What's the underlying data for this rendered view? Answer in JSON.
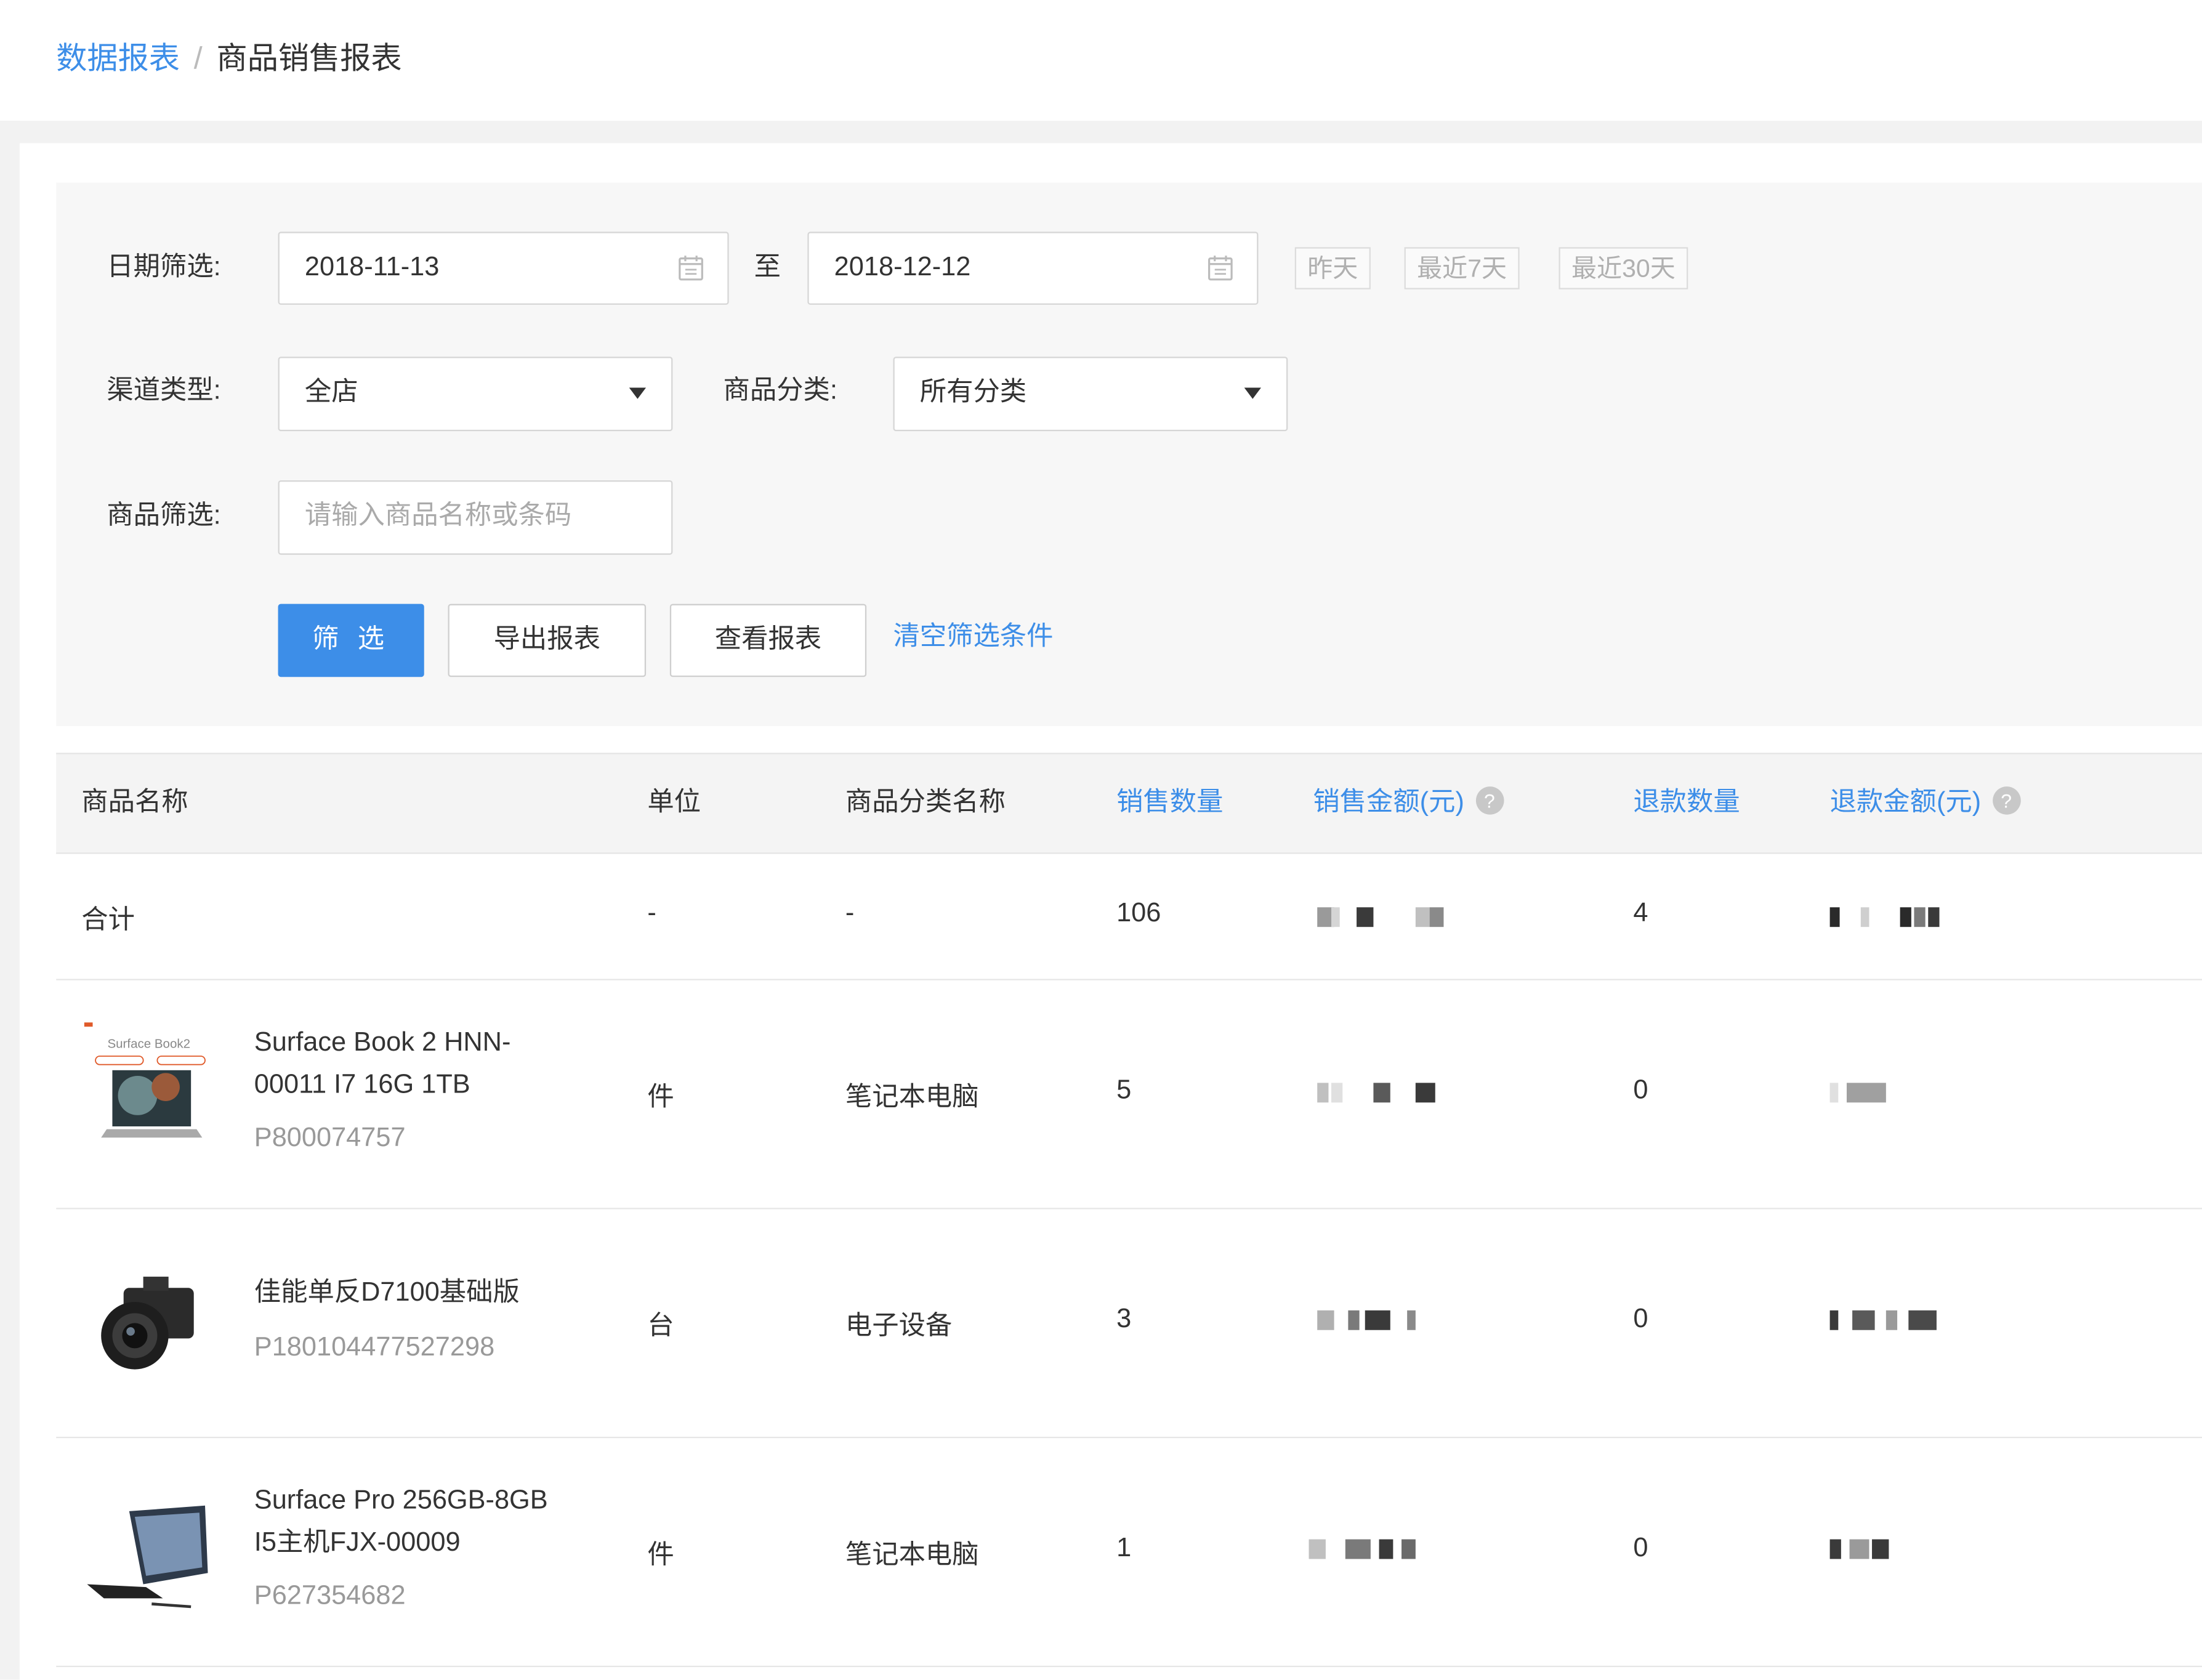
{
  "breadcrumb": {
    "parent": "数据报表",
    "separator": "/",
    "current": "商品销售报表"
  },
  "filters": {
    "date_label": "日期筛选:",
    "date_start": "2018-11-13",
    "date_to": "至",
    "date_end": "2018-12-12",
    "quick_ranges": [
      "昨天",
      "最近7天",
      "最近30天"
    ],
    "channel_label": "渠道类型:",
    "channel_value": "全店",
    "category_label": "商品分类:",
    "category_value": "所有分类",
    "product_label": "商品筛选:",
    "product_placeholder": "请输入商品名称或条码"
  },
  "actions": {
    "filter": "筛 选",
    "export": "导出报表",
    "view": "查看报表",
    "clear": "清空筛选条件"
  },
  "table": {
    "columns": [
      "商品名称",
      "单位",
      "商品分类名称",
      "销售数量",
      "销售金额(元)",
      "退款数量",
      "退款金额(元)"
    ],
    "help_icon": "?",
    "total": {
      "name": "合计",
      "unit": "-",
      "category": "-",
      "sales_qty": "106",
      "refund_qty": "4"
    },
    "rows": [
      {
        "name_line1": "Surface Book 2 HNN-",
        "name_line2": "00011 I7 16G 1TB",
        "code": "P800074757",
        "unit": "件",
        "category": "笔记本电脑",
        "sales_qty": "5",
        "refund_qty": "0",
        "thumb_icon": "laptop-icon",
        "thumb_text": "Surface Book2"
      },
      {
        "name_line1": "佳能单反D7100基础版",
        "name_line2": "",
        "code": "P180104477527298",
        "unit": "台",
        "category": "电子设备",
        "sales_qty": "3",
        "refund_qty": "0",
        "thumb_icon": "camera-icon"
      },
      {
        "name_line1": "Surface Pro 256GB-8GB",
        "name_line2": "I5主机FJX-00009",
        "code": "P627354682",
        "unit": "件",
        "category": "笔记本电脑",
        "sales_qty": "1",
        "refund_qty": "0",
        "thumb_icon": "tablet-icon"
      }
    ]
  },
  "colors": {
    "primary": "#3d8ee8",
    "text": "#333333",
    "muted": "#999999",
    "panel_bg": "#f7f7f7"
  }
}
